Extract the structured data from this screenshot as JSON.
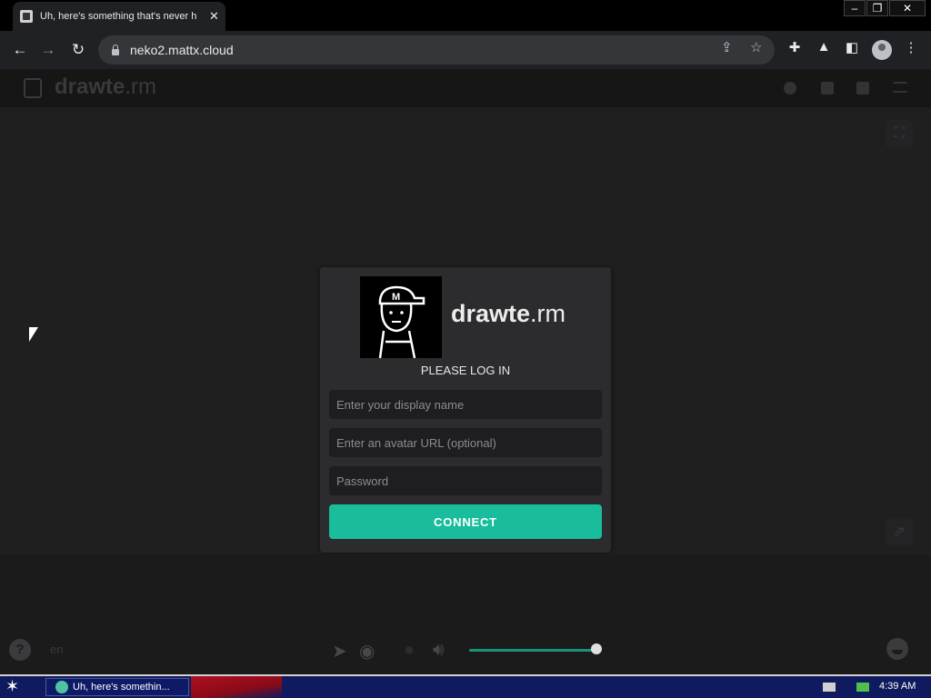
{
  "browser": {
    "tab_title": "Uh, here's something that's never h",
    "url": "neko2.mattx.cloud"
  },
  "app": {
    "brand_main": "drawte",
    "brand_suffix": ".rm"
  },
  "login": {
    "heading": "PLEASE LOG IN",
    "display_name_placeholder": "Enter your display name",
    "avatar_placeholder": "Enter an avatar URL (optional)",
    "password_placeholder": "Password",
    "connect_label": "CONNECT"
  },
  "controls": {
    "language": "en",
    "volume_level": 1.0
  },
  "taskbar": {
    "task_label": "Uh, here's somethin...",
    "clock": "4:39 AM"
  },
  "colors": {
    "accent": "#19bd9c",
    "modal_bg": "#2c2c2f",
    "page_bg": "#1b1b1c"
  }
}
